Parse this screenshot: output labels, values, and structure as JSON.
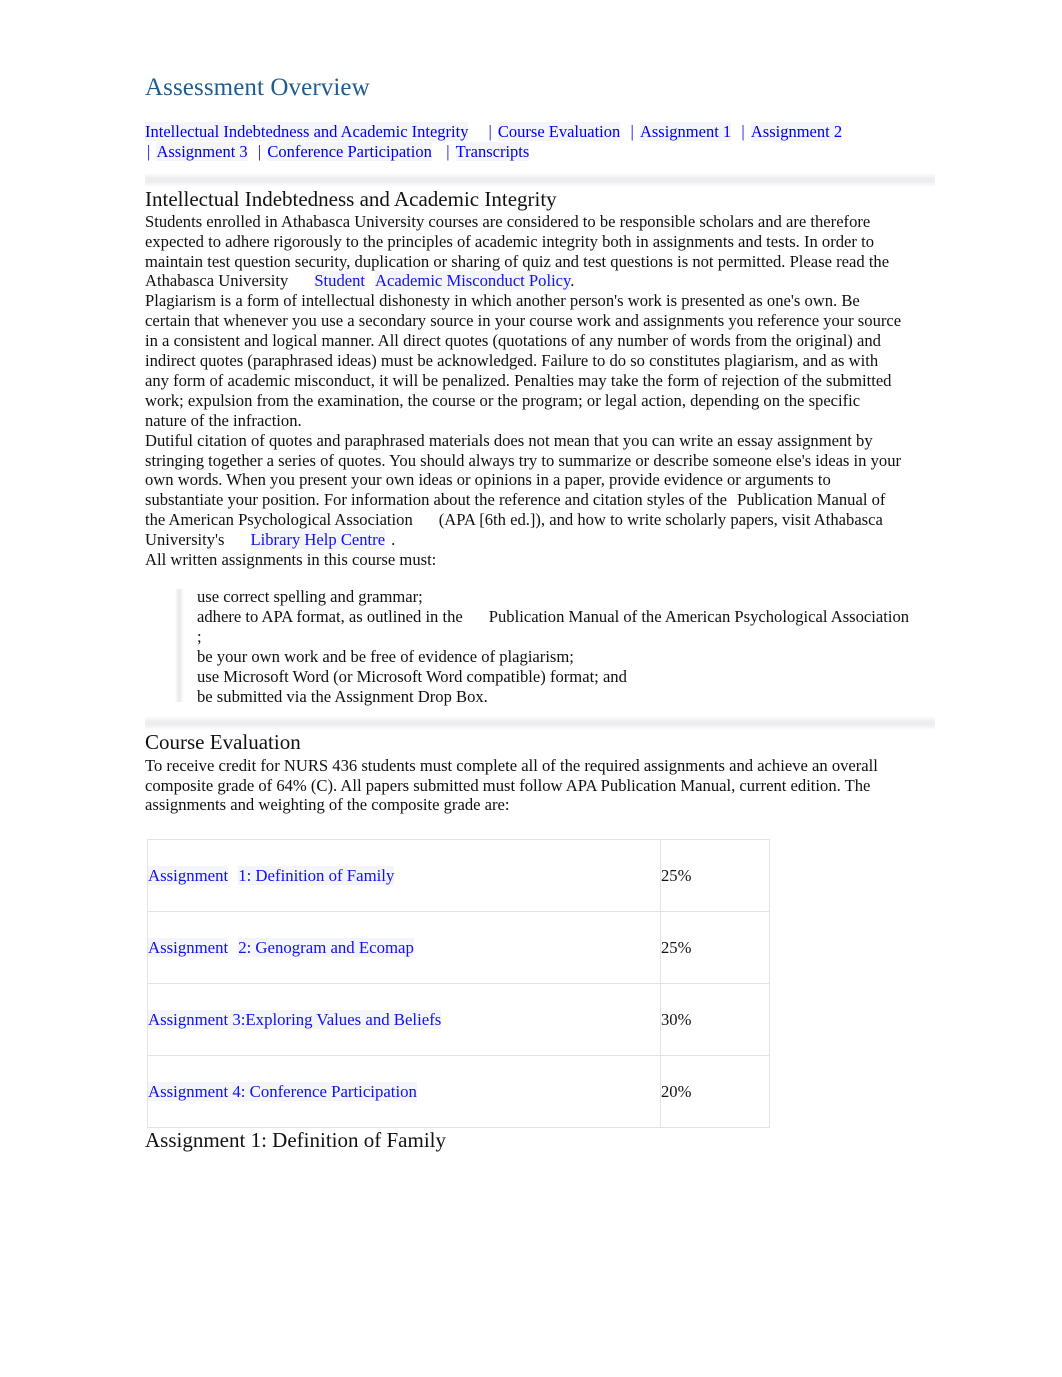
{
  "document": {
    "title": "Assessment Overview",
    "title_color": "#1F5C8F",
    "link_color": "#0000EE",
    "body_text_color": "#101010",
    "background_color": "#FFFFFF",
    "table_border_color": "#E3E3E5"
  },
  "nav": {
    "items": [
      {
        "label": "Intellectual Indebtedness and Academic Integrity"
      },
      {
        "label": "Course Evaluation"
      },
      {
        "label": "Assignment 1"
      },
      {
        "label": "Assignment 2"
      },
      {
        "label": "Assignment 3"
      },
      {
        "label": "Conference Participation"
      },
      {
        "label": "Transcripts"
      }
    ],
    "separator": "|"
  },
  "section_integrity": {
    "heading": "Intellectual Indebtedness and Academic Integrity",
    "para1_a": "Students enrolled in Athabasca University courses are considered to be responsible scholars and are therefore expected to adhere rigorously to the principles of academic integrity both in assignments and tests. In order to maintain test question security, duplication or sharing of quiz and test questions is not permitted. Please read the Athabasca University",
    "para1_link_a": "Student",
    "para1_link_b": "Academic Misconduct Policy",
    "para1_end": ".",
    "para2": "Plagiarism is a form of intellectual dishonesty in which another person's work is presented as one's own. Be certain that whenever you use a secondary source in your course work and assignments you reference your source in a consistent and logical manner. All direct quotes (quotations of any number of words from the original) and indirect quotes (paraphrased ideas) must be acknowledged. Failure to do so constitutes plagiarism, and as with any form of academic misconduct, it will be penalized. Penalties may take the form of rejection of the submitted work; expulsion from the examination, the course or the program; or legal action, depending on the specific nature of the infraction.",
    "para3_a": "Dutiful citation of quotes and paraphrased materials does not mean that you can write an essay assignment by stringing together a series of quotes. You should always try to summarize or describe someone else's ideas in your own words. When you present your own ideas or opinions in a paper, provide evidence or arguments to substantiate your position. For information about the reference and citation styles of the",
    "para3_cite": "Publication Manual of the American Psychological Association",
    "para3_b": "(APA [6th ed.]), and how to write scholarly papers, visit Athabasca University's",
    "para3_link": "Library Help Centre",
    "para3_end": ".",
    "list_intro": "All written assignments in this course must:",
    "list_items": [
      {
        "text": "use correct spelling and grammar;"
      },
      {
        "text_a": "adhere to APA format, as outlined in the",
        "cite": "Publication Manual of the American Psychological Association",
        "text_b": ";"
      },
      {
        "text": "be your own work and be free of evidence of plagiarism;"
      },
      {
        "text": "use Microsoft Word (or Microsoft Word compatible) format; and"
      },
      {
        "text": "be submitted via the Assignment Drop Box."
      }
    ]
  },
  "section_evaluation": {
    "heading": "Course Evaluation",
    "paragraph": "To receive credit for NURS 436 students must complete all of the required assignments and achieve an overall composite grade of 64% (C). All papers submitted must follow APA Publication Manual, current edition. The assignments and weighting of the composite grade are:",
    "table": {
      "rows": [
        {
          "name_a": "Assignment",
          "name_b": "1: Definition of Family",
          "split": true,
          "weight": "25%"
        },
        {
          "name_a": "Assignment",
          "name_b": "2: Genogram and Ecomap",
          "split": true,
          "weight": "25%"
        },
        {
          "name_a": "Assignment 3:Exploring Values and Beliefs",
          "name_b": "",
          "split": false,
          "weight": "30%"
        },
        {
          "name_a": "Assignment 4: Conference Participation",
          "name_b": "",
          "split": false,
          "weight": "20%"
        }
      ]
    }
  },
  "section_assignment1": {
    "heading": "Assignment 1: Definition of Family"
  }
}
